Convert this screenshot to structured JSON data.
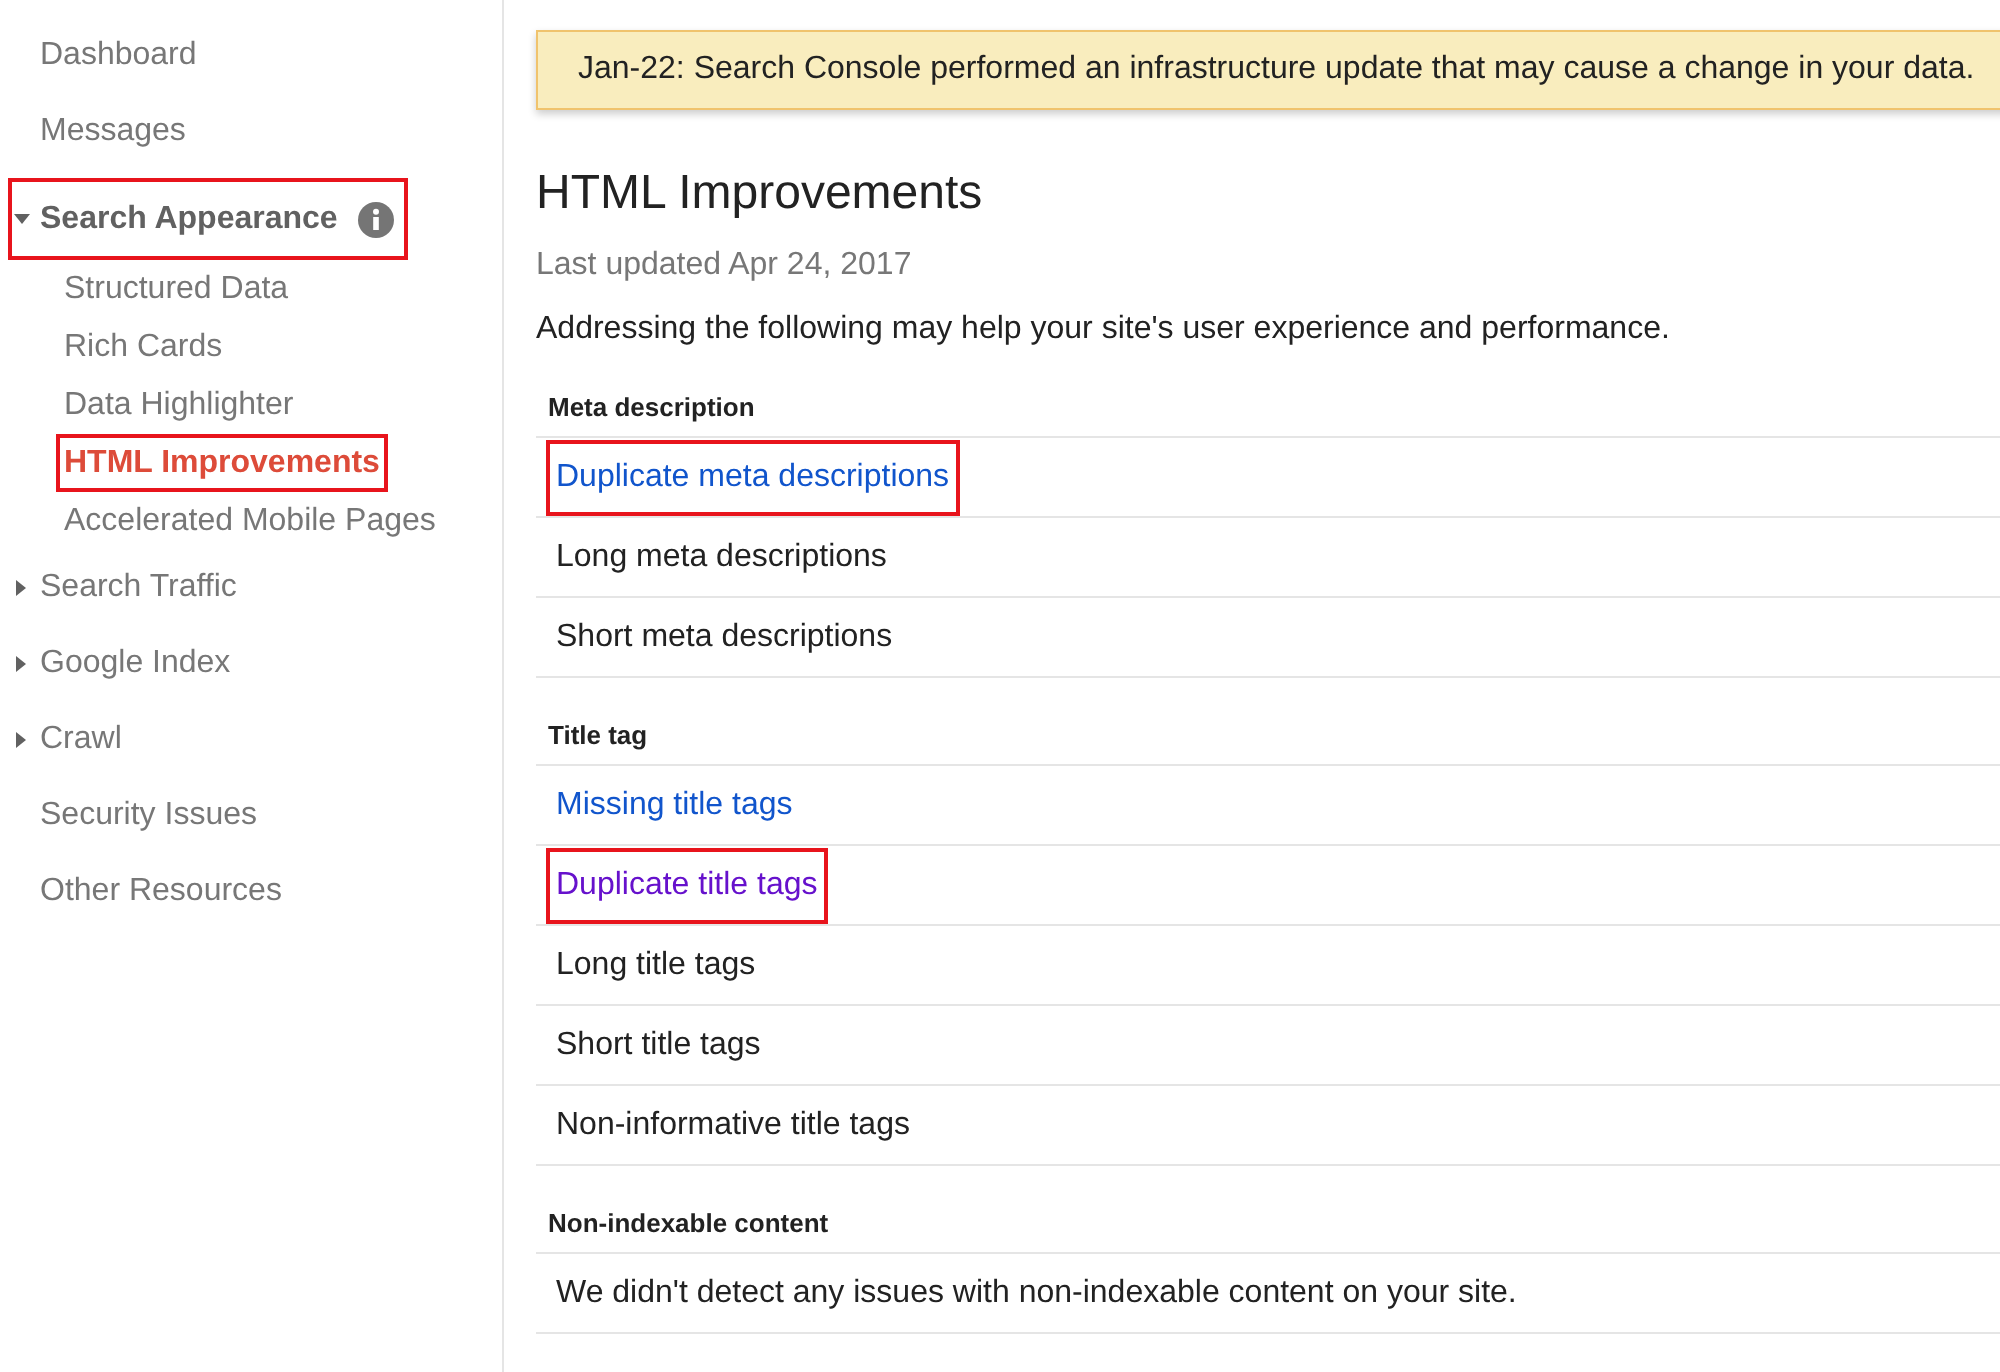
{
  "sidebar": {
    "items": [
      {
        "label": "Dashboard",
        "kind": "plain",
        "selected": false,
        "highlighted": false
      },
      {
        "label": "Messages",
        "kind": "plain",
        "selected": false,
        "highlighted": false
      },
      {
        "label": "Search Appearance",
        "kind": "group",
        "expanded": true,
        "selected": false,
        "highlighted": true,
        "info": true,
        "children": [
          {
            "label": "Structured Data",
            "selected": false,
            "highlighted": false
          },
          {
            "label": "Rich Cards",
            "selected": false,
            "highlighted": false
          },
          {
            "label": "Data Highlighter",
            "selected": false,
            "highlighted": false
          },
          {
            "label": "HTML Improvements",
            "selected": true,
            "highlighted": true
          },
          {
            "label": "Accelerated Mobile Pages",
            "selected": false,
            "highlighted": false
          }
        ]
      },
      {
        "label": "Search Traffic",
        "kind": "group",
        "expanded": false,
        "selected": false,
        "highlighted": false
      },
      {
        "label": "Google Index",
        "kind": "group",
        "expanded": false,
        "selected": false,
        "highlighted": false
      },
      {
        "label": "Crawl",
        "kind": "group",
        "expanded": false,
        "selected": false,
        "highlighted": false
      },
      {
        "label": "Security Issues",
        "kind": "plain",
        "selected": false,
        "highlighted": false
      },
      {
        "label": "Other Resources",
        "kind": "plain",
        "selected": false,
        "highlighted": false
      }
    ]
  },
  "notice": {
    "text": "Jan-22: Search Console performed an infrastructure update that may cause a change in your data."
  },
  "page": {
    "title": "HTML Improvements",
    "last_updated": "Last updated Apr 24, 2017",
    "intro": "Addressing the following may help your site's user experience and performance."
  },
  "sections": [
    {
      "heading": "Meta description",
      "rows": [
        {
          "label": "Duplicate meta descriptions",
          "kind": "link",
          "highlighted": true
        },
        {
          "label": "Long meta descriptions",
          "kind": "plain",
          "highlighted": false
        },
        {
          "label": "Short meta descriptions",
          "kind": "plain",
          "highlighted": false
        }
      ]
    },
    {
      "heading": "Title tag",
      "rows": [
        {
          "label": "Missing title tags",
          "kind": "link",
          "highlighted": false
        },
        {
          "label": "Duplicate title tags",
          "kind": "visited",
          "highlighted": true
        },
        {
          "label": "Long title tags",
          "kind": "plain",
          "highlighted": false
        },
        {
          "label": "Short title tags",
          "kind": "plain",
          "highlighted": false
        },
        {
          "label": "Non-informative title tags",
          "kind": "plain",
          "highlighted": false
        }
      ]
    },
    {
      "heading": "Non-indexable content",
      "rows": [
        {
          "label": "We didn't detect any issues with non-indexable content on your site.",
          "kind": "plain",
          "highlighted": false
        }
      ]
    }
  ]
}
